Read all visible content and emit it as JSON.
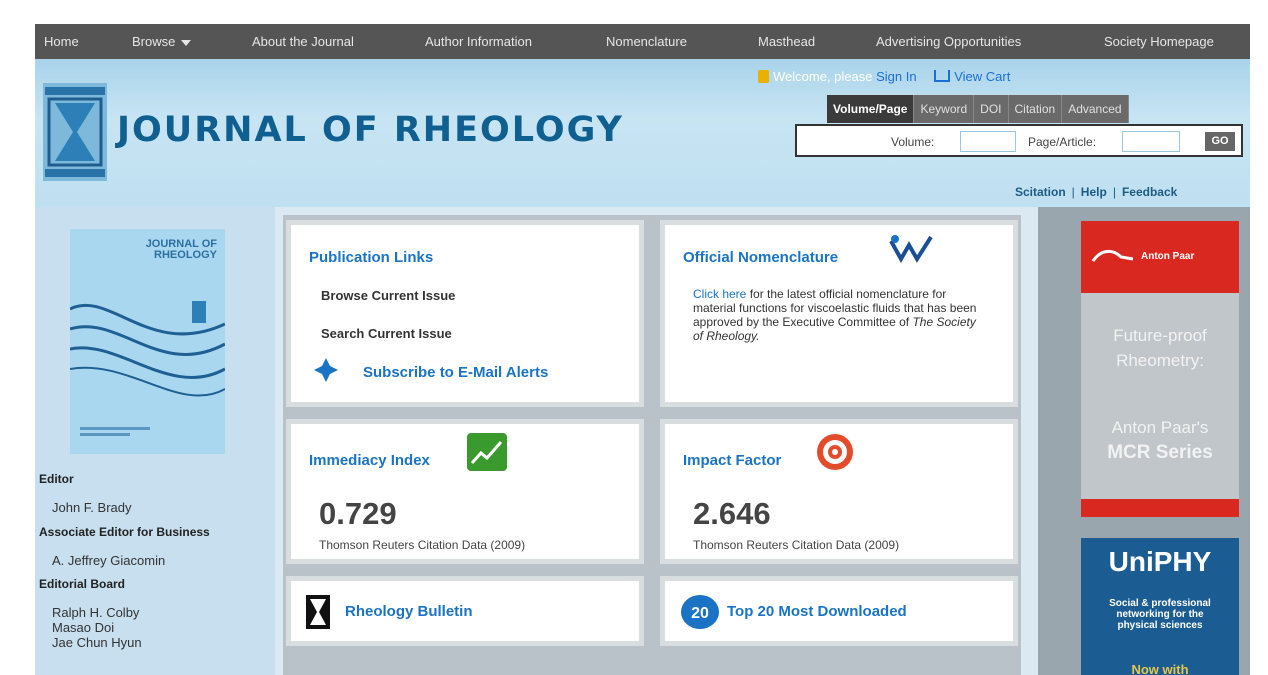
{
  "nav": {
    "items": [
      "Home",
      "Browse",
      "About the Journal",
      "Author Information",
      "Nomenclature",
      "Masthead",
      "Advertising Opportunities",
      "Society Homepage"
    ]
  },
  "header": {
    "title": "JOURNAL OF RHEOLOGY",
    "welcome_text": "Welcome, please",
    "sign_in": "Sign In",
    "view_cart": "View Cart",
    "tabs": [
      "Volume/Page",
      "Keyword",
      "DOI",
      "Citation",
      "Advanced"
    ],
    "volume_label": "Volume:",
    "page_label": "Page/Article:",
    "go_label": "GO",
    "links": [
      "Scitation",
      "Help",
      "Feedback"
    ]
  },
  "sidebar": {
    "cover_title": "JOURNAL OF RHEOLOGY",
    "editor_heading": "Editor",
    "editor_name": "John F. Brady",
    "assoc_heading": "Associate Editor for Business",
    "assoc_name": "A. Jeffrey Giacomin",
    "board_heading": "Editorial Board",
    "board_names": [
      "Ralph H. Colby",
      "Masao Doi",
      "Jae Chun Hyun"
    ]
  },
  "cards": {
    "publication": {
      "title": "Publication Links",
      "browse": "Browse Current Issue",
      "search": "Search Current Issue",
      "subscribe": "Subscribe to E-Mail Alerts"
    },
    "nomenclature": {
      "title": "Official Nomenclature",
      "click_here": "Click here",
      "text1": "for the latest official nomenclature for material functions for viscoelastic fluids that has been approved by the Executive Committee of",
      "society": "The Society of Rheology."
    },
    "immediacy": {
      "title": "Immediacy Index",
      "value": "0.729",
      "caption": "Thomson Reuters Citation Data (2009)"
    },
    "impact": {
      "title": "Impact Factor",
      "value": "2.646",
      "caption": "Thomson Reuters Citation Data (2009)"
    },
    "bulletin": {
      "title": "Rheology Bulletin"
    },
    "top20": {
      "title": "Top 20 Most Downloaded"
    }
  },
  "ads": {
    "anton_brand": "Anton Paar",
    "anton_line1": "Future-proof",
    "anton_line2": "Rheometry:",
    "anton_line3": "Anton Paar's",
    "anton_line4": "MCR Series",
    "uniphy": "UniPHY",
    "uniphy_sub1": "Social & professional",
    "uniphy_sub2": "networking for the",
    "uniphy_sub3": "physical sciences",
    "uniphy_now": "Now with"
  },
  "colors": {
    "nav_bg": "#555555",
    "link_blue": "#1a73c4",
    "title_blue": "#0f5f90",
    "anton_red": "#d8281f",
    "uniphy_blue": "#1b5c93"
  }
}
